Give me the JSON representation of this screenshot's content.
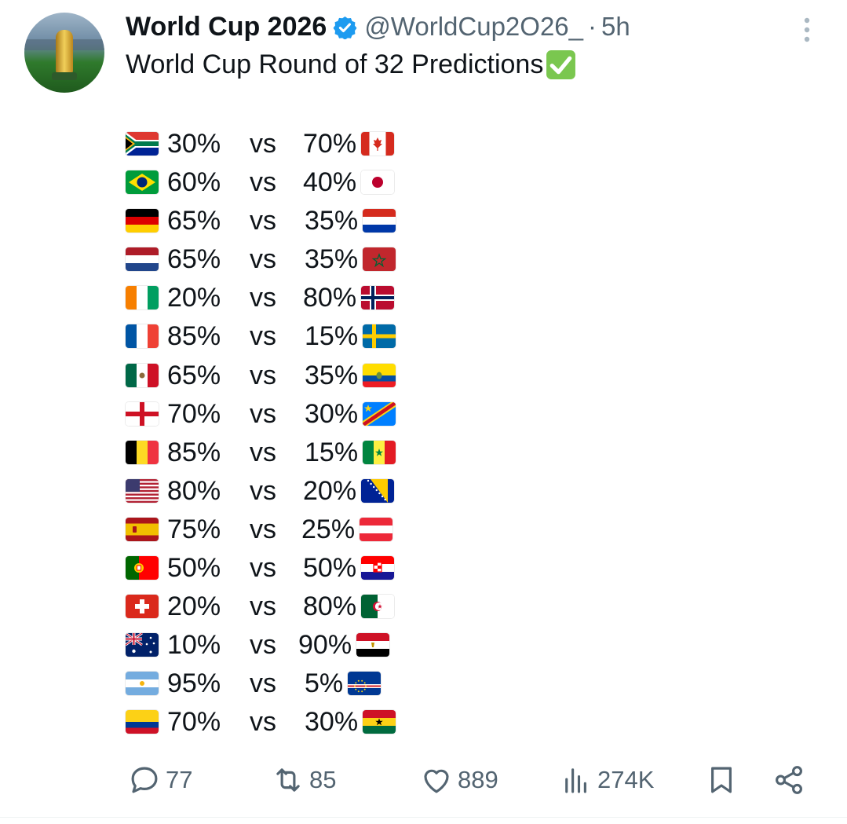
{
  "tweet": {
    "author_name": "World Cup 2026",
    "handle": "@WorldCup2O26_",
    "separator": "·",
    "time": "5h",
    "text": "World Cup Round of 32 Predictions"
  },
  "predictions": [
    {
      "home_flag": "South Africa",
      "home_pct": "30%",
      "vs": "vs",
      "away_pct": "70%",
      "away_flag": "Canada"
    },
    {
      "home_flag": "Brazil",
      "home_pct": "60%",
      "vs": "vs",
      "away_pct": "40%",
      "away_flag": "Japan"
    },
    {
      "home_flag": "Germany",
      "home_pct": "65%",
      "vs": "vs",
      "away_pct": "35%",
      "away_flag": "Paraguay"
    },
    {
      "home_flag": "Netherlands",
      "home_pct": "65%",
      "vs": "vs",
      "away_pct": "35%",
      "away_flag": "Morocco"
    },
    {
      "home_flag": "Ivory Coast",
      "home_pct": "20%",
      "vs": "vs",
      "away_pct": "80%",
      "away_flag": "Norway"
    },
    {
      "home_flag": "France",
      "home_pct": "85%",
      "vs": "vs",
      "away_pct": "15%",
      "away_flag": "Sweden"
    },
    {
      "home_flag": "Mexico",
      "home_pct": "65%",
      "vs": "vs",
      "away_pct": "35%",
      "away_flag": "Ecuador"
    },
    {
      "home_flag": "England",
      "home_pct": "70%",
      "vs": "vs",
      "away_pct": "30%",
      "away_flag": "DR Congo"
    },
    {
      "home_flag": "Belgium",
      "home_pct": "85%",
      "vs": "vs",
      "away_pct": "15%",
      "away_flag": "Senegal"
    },
    {
      "home_flag": "United States",
      "home_pct": "80%",
      "vs": "vs",
      "away_pct": "20%",
      "away_flag": "Bosnia and Herzegovina"
    },
    {
      "home_flag": "Spain",
      "home_pct": "75%",
      "vs": "vs",
      "away_pct": "25%",
      "away_flag": "Austria"
    },
    {
      "home_flag": "Portugal",
      "home_pct": "50%",
      "vs": "vs",
      "away_pct": "50%",
      "away_flag": "Croatia"
    },
    {
      "home_flag": "Switzerland",
      "home_pct": "20%",
      "vs": "vs",
      "away_pct": "80%",
      "away_flag": "Algeria"
    },
    {
      "home_flag": "Australia",
      "home_pct": "10%",
      "vs": "vs",
      "away_pct": "90%",
      "away_flag": "Egypt"
    },
    {
      "home_flag": "Argentina",
      "home_pct": "95%",
      "vs": "vs",
      "away_pct": "5%",
      "away_flag": "Cape Verde"
    },
    {
      "home_flag": "Colombia",
      "home_pct": "70%",
      "vs": "vs",
      "away_pct": "30%",
      "away_flag": "Ghana"
    }
  ],
  "actions": {
    "replies": "77",
    "reposts": "85",
    "likes": "889",
    "views": "274K"
  },
  "icons": [
    "verified-badge-icon",
    "more-options-icon",
    "check-mark-emoji-icon",
    "reply-icon",
    "repost-icon",
    "like-icon",
    "views-icon",
    "bookmark-icon",
    "share-icon"
  ],
  "colors": {
    "text": "#0f1419",
    "secondary": "#536471",
    "verified": "#1d9bf0",
    "check": "#7ac74f"
  }
}
